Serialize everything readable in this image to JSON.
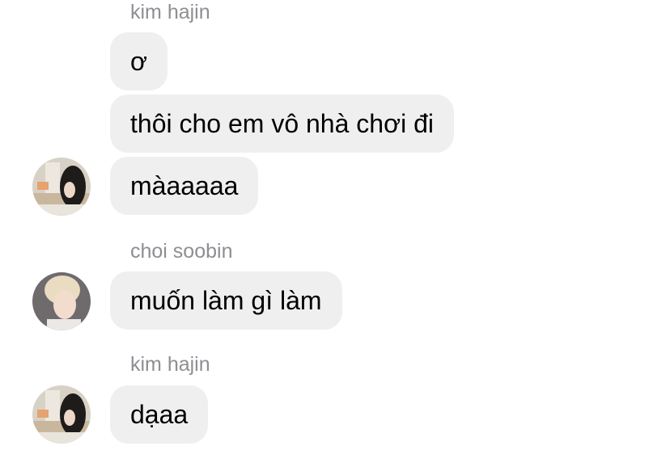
{
  "messages": {
    "group1": {
      "sender": "kim hajin",
      "bubbles": [
        "ơ",
        "thôi cho em vô nhà chơi đi",
        "màaaaaa"
      ]
    },
    "group2": {
      "sender": "choi soobin",
      "bubbles": [
        "muốn làm gì làm"
      ]
    },
    "group3": {
      "sender": "kim hajin",
      "bubbles": [
        "dạaa"
      ]
    }
  },
  "colors": {
    "bubble_background": "#efefef",
    "sender_name": "#8e8e93",
    "message_text": "#000000"
  }
}
